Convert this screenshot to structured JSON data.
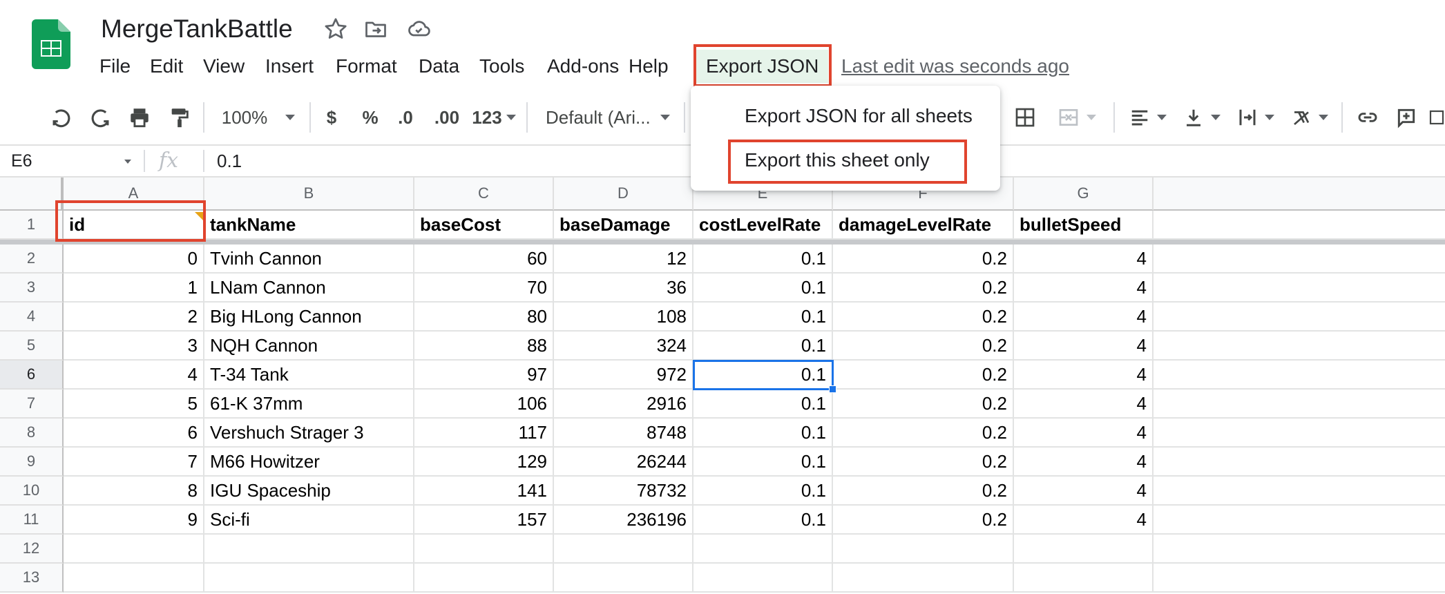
{
  "app": {
    "doc_title": "MergeTankBattle",
    "last_edit": "Last edit was seconds ago"
  },
  "menu": [
    "File",
    "Edit",
    "View",
    "Insert",
    "Format",
    "Data",
    "Tools",
    "Add-ons",
    "Help",
    "Export JSON"
  ],
  "toolbar": {
    "zoom": "100%",
    "currency": "$",
    "percent": "%",
    "decrease_decimal": ".0",
    "increase_decimal": ".00",
    "more_formats": "123",
    "font": "Default (Ari..."
  },
  "formula_bar": {
    "cell_ref": "E6",
    "fx": "fx",
    "value": "0.1"
  },
  "dropdown": {
    "items": [
      "Export JSON for all sheets",
      "Export this sheet only"
    ]
  },
  "sheet": {
    "columns": [
      "A",
      "B",
      "C",
      "D",
      "E",
      "F",
      "G"
    ],
    "row_numbers": [
      "1",
      "2",
      "3",
      "4",
      "5",
      "6",
      "7",
      "8",
      "9",
      "10",
      "11",
      "12",
      "13"
    ],
    "header": [
      "id",
      "tankName",
      "baseCost",
      "baseDamage",
      "costLevelRate",
      "damageLevelRate",
      "bulletSpeed"
    ],
    "rows": [
      [
        "0",
        "Tvinh Cannon",
        "60",
        "12",
        "0.1",
        "0.2",
        "4"
      ],
      [
        "1",
        "LNam Cannon",
        "70",
        "36",
        "0.1",
        "0.2",
        "4"
      ],
      [
        "2",
        "Big HLong Cannon",
        "80",
        "108",
        "0.1",
        "0.2",
        "4"
      ],
      [
        "3",
        "NQH Cannon",
        "88",
        "324",
        "0.1",
        "0.2",
        "4"
      ],
      [
        "4",
        "T-34 Tank",
        "97",
        "972",
        "0.1",
        "0.2",
        "4"
      ],
      [
        "5",
        "61-K 37mm",
        "106",
        "2916",
        "0.1",
        "0.2",
        "4"
      ],
      [
        "6",
        "Vershuch Strager 3",
        "117",
        "8748",
        "0.1",
        "0.2",
        "4"
      ],
      [
        "7",
        "M66 Howitzer",
        "129",
        "26244",
        "0.1",
        "0.2",
        "4"
      ],
      [
        "8",
        "IGU Spaceship",
        "141",
        "78732",
        "0.1",
        "0.2",
        "4"
      ],
      [
        "9",
        "Sci-fi",
        "157",
        "236196",
        "0.1",
        "0.2",
        "4"
      ]
    ],
    "selected_cell": "E6"
  },
  "colors": {
    "accent": "#1a73e8",
    "highlight_box": "#e0442e",
    "sheets_green": "#0f9d58"
  }
}
